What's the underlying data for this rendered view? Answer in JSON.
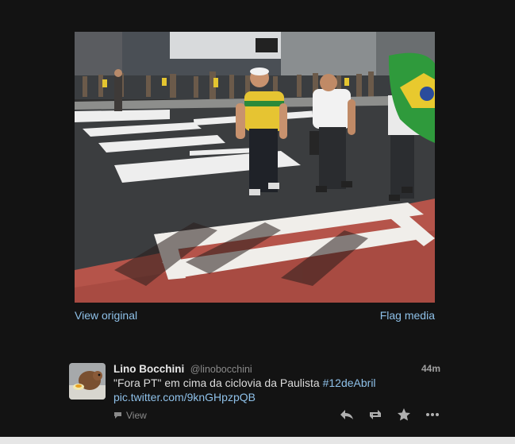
{
  "media": {
    "view_original": "View original",
    "flag_media": "Flag media"
  },
  "tweet": {
    "author_name": "Lino Bocchini",
    "author_handle": "@linobocchini",
    "time": "44m",
    "text": "\"Fora PT\" em cima da ciclovia da Paulista",
    "hashtag": "#12deAbril",
    "link": "pic.twitter.com/9knGHpzpQB",
    "view_label": "View"
  },
  "icons": {
    "reply": "reply-icon",
    "retweet": "retweet-icon",
    "favorite": "star-icon",
    "more": "more-icon",
    "view": "speech-bubble-icon"
  },
  "colors": {
    "background": "#131313",
    "link": "#8ec0e8",
    "text": "#dcdcdc",
    "muted": "#8a8a8a"
  }
}
